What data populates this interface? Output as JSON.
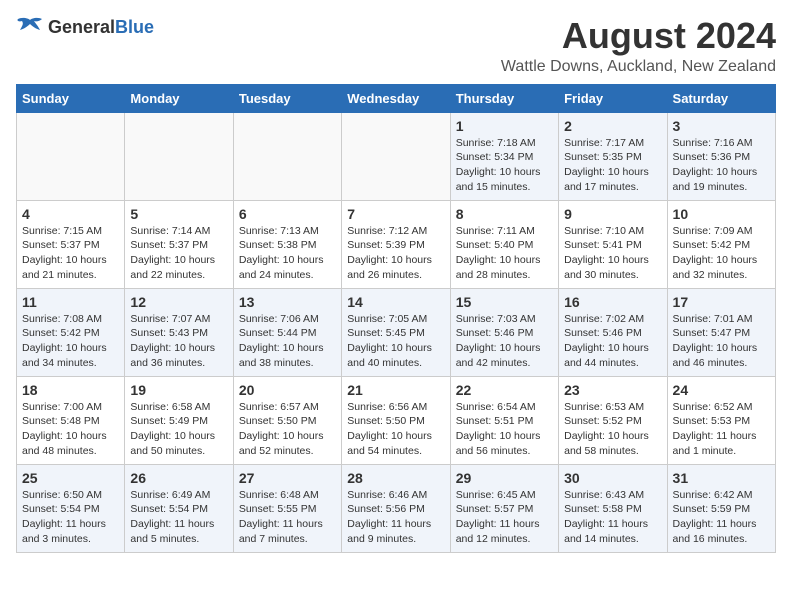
{
  "header": {
    "logo_general": "General",
    "logo_blue": "Blue",
    "title": "August 2024",
    "subtitle": "Wattle Downs, Auckland, New Zealand"
  },
  "calendar": {
    "days_of_week": [
      "Sunday",
      "Monday",
      "Tuesday",
      "Wednesday",
      "Thursday",
      "Friday",
      "Saturday"
    ],
    "weeks": [
      [
        {
          "day": "",
          "info": ""
        },
        {
          "day": "",
          "info": ""
        },
        {
          "day": "",
          "info": ""
        },
        {
          "day": "",
          "info": ""
        },
        {
          "day": "1",
          "info": "Sunrise: 7:18 AM\nSunset: 5:34 PM\nDaylight: 10 hours\nand 15 minutes."
        },
        {
          "day": "2",
          "info": "Sunrise: 7:17 AM\nSunset: 5:35 PM\nDaylight: 10 hours\nand 17 minutes."
        },
        {
          "day": "3",
          "info": "Sunrise: 7:16 AM\nSunset: 5:36 PM\nDaylight: 10 hours\nand 19 minutes."
        }
      ],
      [
        {
          "day": "4",
          "info": "Sunrise: 7:15 AM\nSunset: 5:37 PM\nDaylight: 10 hours\nand 21 minutes."
        },
        {
          "day": "5",
          "info": "Sunrise: 7:14 AM\nSunset: 5:37 PM\nDaylight: 10 hours\nand 22 minutes."
        },
        {
          "day": "6",
          "info": "Sunrise: 7:13 AM\nSunset: 5:38 PM\nDaylight: 10 hours\nand 24 minutes."
        },
        {
          "day": "7",
          "info": "Sunrise: 7:12 AM\nSunset: 5:39 PM\nDaylight: 10 hours\nand 26 minutes."
        },
        {
          "day": "8",
          "info": "Sunrise: 7:11 AM\nSunset: 5:40 PM\nDaylight: 10 hours\nand 28 minutes."
        },
        {
          "day": "9",
          "info": "Sunrise: 7:10 AM\nSunset: 5:41 PM\nDaylight: 10 hours\nand 30 minutes."
        },
        {
          "day": "10",
          "info": "Sunrise: 7:09 AM\nSunset: 5:42 PM\nDaylight: 10 hours\nand 32 minutes."
        }
      ],
      [
        {
          "day": "11",
          "info": "Sunrise: 7:08 AM\nSunset: 5:42 PM\nDaylight: 10 hours\nand 34 minutes."
        },
        {
          "day": "12",
          "info": "Sunrise: 7:07 AM\nSunset: 5:43 PM\nDaylight: 10 hours\nand 36 minutes."
        },
        {
          "day": "13",
          "info": "Sunrise: 7:06 AM\nSunset: 5:44 PM\nDaylight: 10 hours\nand 38 minutes."
        },
        {
          "day": "14",
          "info": "Sunrise: 7:05 AM\nSunset: 5:45 PM\nDaylight: 10 hours\nand 40 minutes."
        },
        {
          "day": "15",
          "info": "Sunrise: 7:03 AM\nSunset: 5:46 PM\nDaylight: 10 hours\nand 42 minutes."
        },
        {
          "day": "16",
          "info": "Sunrise: 7:02 AM\nSunset: 5:46 PM\nDaylight: 10 hours\nand 44 minutes."
        },
        {
          "day": "17",
          "info": "Sunrise: 7:01 AM\nSunset: 5:47 PM\nDaylight: 10 hours\nand 46 minutes."
        }
      ],
      [
        {
          "day": "18",
          "info": "Sunrise: 7:00 AM\nSunset: 5:48 PM\nDaylight: 10 hours\nand 48 minutes."
        },
        {
          "day": "19",
          "info": "Sunrise: 6:58 AM\nSunset: 5:49 PM\nDaylight: 10 hours\nand 50 minutes."
        },
        {
          "day": "20",
          "info": "Sunrise: 6:57 AM\nSunset: 5:50 PM\nDaylight: 10 hours\nand 52 minutes."
        },
        {
          "day": "21",
          "info": "Sunrise: 6:56 AM\nSunset: 5:50 PM\nDaylight: 10 hours\nand 54 minutes."
        },
        {
          "day": "22",
          "info": "Sunrise: 6:54 AM\nSunset: 5:51 PM\nDaylight: 10 hours\nand 56 minutes."
        },
        {
          "day": "23",
          "info": "Sunrise: 6:53 AM\nSunset: 5:52 PM\nDaylight: 10 hours\nand 58 minutes."
        },
        {
          "day": "24",
          "info": "Sunrise: 6:52 AM\nSunset: 5:53 PM\nDaylight: 11 hours\nand 1 minute."
        }
      ],
      [
        {
          "day": "25",
          "info": "Sunrise: 6:50 AM\nSunset: 5:54 PM\nDaylight: 11 hours\nand 3 minutes."
        },
        {
          "day": "26",
          "info": "Sunrise: 6:49 AM\nSunset: 5:54 PM\nDaylight: 11 hours\nand 5 minutes."
        },
        {
          "day": "27",
          "info": "Sunrise: 6:48 AM\nSunset: 5:55 PM\nDaylight: 11 hours\nand 7 minutes."
        },
        {
          "day": "28",
          "info": "Sunrise: 6:46 AM\nSunset: 5:56 PM\nDaylight: 11 hours\nand 9 minutes."
        },
        {
          "day": "29",
          "info": "Sunrise: 6:45 AM\nSunset: 5:57 PM\nDaylight: 11 hours\nand 12 minutes."
        },
        {
          "day": "30",
          "info": "Sunrise: 6:43 AM\nSunset: 5:58 PM\nDaylight: 11 hours\nand 14 minutes."
        },
        {
          "day": "31",
          "info": "Sunrise: 6:42 AM\nSunset: 5:59 PM\nDaylight: 11 hours\nand 16 minutes."
        }
      ]
    ]
  }
}
